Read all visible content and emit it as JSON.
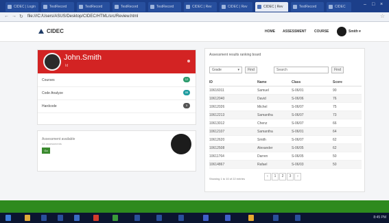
{
  "browser": {
    "tabs": [
      {
        "label": "CIDEC | Login"
      },
      {
        "label": "TestRecord"
      },
      {
        "label": "TestRecord"
      },
      {
        "label": "TestRecord"
      },
      {
        "label": "TestRecord"
      },
      {
        "label": "CIDEC | Rev"
      },
      {
        "label": "CIDEC | Rev"
      },
      {
        "label": "CIDEC | Rev"
      },
      {
        "label": "TestRecord"
      },
      {
        "label": "CIDEC"
      }
    ],
    "active_tab": 7,
    "url": "file:///C:/Users/ASUS/Desktop/CIDEC/HTML/src/Review.html"
  },
  "header": {
    "logo": "CIDEC",
    "nav": [
      "HOME",
      "ASSESSMENT",
      "COURSE"
    ],
    "user": "Smith ▾"
  },
  "profile": {
    "name": "John.Smith",
    "sub": "Id",
    "menu": [
      {
        "label": "Courses",
        "badge": "12",
        "badge_color": "#2e9c6e"
      },
      {
        "label": "Code Analyze",
        "badge": "05",
        "badge_color": "#1f9ca0"
      },
      {
        "label": "Hardcode",
        "badge": "3",
        "badge_color": "#555555"
      }
    ]
  },
  "notification": {
    "title": "Assessment available",
    "sub": "All assessments",
    "button": "Go"
  },
  "table_card": {
    "title": "Assessment results ranking board",
    "select_value": "Grade",
    "find_label_1": "Find",
    "search_placeholder": "Search",
    "find_label_2": "Find",
    "columns": [
      "ID",
      "Name",
      "Class",
      "Score"
    ],
    "rows": [
      [
        "10616011",
        "Samuel",
        "S-06/01",
        "90"
      ],
      [
        "10612040",
        "David",
        "S-06/06",
        "76"
      ],
      [
        "10612026",
        "Michel",
        "S-06/07",
        "75"
      ],
      [
        "10612213",
        "Samantha",
        "S-06/07",
        "73"
      ],
      [
        "10613012",
        "Chenz",
        "S-06/07",
        "66"
      ],
      [
        "10612107",
        "Samantha",
        "S-06/01",
        "64"
      ],
      [
        "10612620",
        "Smith",
        "S-06/07",
        "62"
      ],
      [
        "10612508",
        "Alexander",
        "S-06/05",
        "62"
      ],
      [
        "10611764",
        "Darren",
        "S-06/05",
        "50"
      ],
      [
        "10614867",
        "Rafael",
        "S-06/03",
        "50"
      ]
    ],
    "footer": "Showing 1 to 10 of 22 entries",
    "pager": [
      "‹",
      "1",
      "2",
      "3",
      "›"
    ]
  },
  "taskbar": {
    "tray_time": "8:45 PM"
  }
}
